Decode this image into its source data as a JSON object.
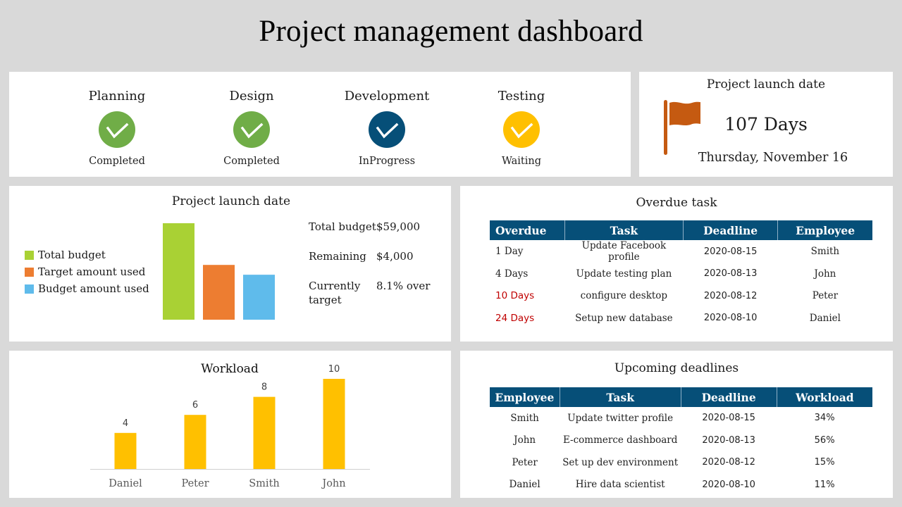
{
  "title": "Project management dashboard",
  "phases": [
    {
      "name": "Planning",
      "status": "Completed",
      "icon": "check-circle-icon",
      "color": "#70ad47"
    },
    {
      "name": "Design",
      "status": "Completed",
      "icon": "check-circle-icon",
      "color": "#70ad47"
    },
    {
      "name": "Development",
      "status": "InProgress",
      "icon": "check-circle-icon",
      "color": "#064f78"
    },
    {
      "name": "Testing",
      "status": "Waiting",
      "icon": "check-circle-icon",
      "color": "#ffc000"
    }
  ],
  "launch": {
    "title": "Project launch date",
    "icon": "flag-icon",
    "icon_color": "#c55a11",
    "days": "107 Days",
    "date": "Thursday, November 16"
  },
  "budget": {
    "title": "Project launch date",
    "stats": [
      {
        "label": "Total budget",
        "value": "$59,000"
      },
      {
        "label": "Remaining",
        "value": "$4,000"
      },
      {
        "label": "Currently target",
        "value": "8.1% over"
      }
    ]
  },
  "overdue": {
    "title": "Overdue task",
    "headers": [
      "Overdue",
      "Task",
      "Deadline",
      "Employee"
    ],
    "rows": [
      {
        "overdue": "1 Day",
        "task": "Update Facebook profile",
        "deadline": "2020-08-15",
        "employee": "Smith",
        "alert": false
      },
      {
        "overdue": "4 Days",
        "task": "Update testing plan",
        "deadline": "2020-08-13",
        "employee": "John",
        "alert": false
      },
      {
        "overdue": "10 Days",
        "task": "configure desktop",
        "deadline": "2020-08-12",
        "employee": "Peter",
        "alert": true
      },
      {
        "overdue": "24 Days",
        "task": "Setup new database",
        "deadline": "2020-08-10",
        "employee": "Daniel",
        "alert": true
      }
    ],
    "alert_color": "#c00000",
    "header_color": "#064f78"
  },
  "upcoming": {
    "title": "Upcoming deadlines",
    "headers": [
      "Employee",
      "Task",
      "Deadline",
      "Workload"
    ],
    "rows": [
      {
        "employee": "Smith",
        "task": "Update twitter profile",
        "deadline": "2020-08-15",
        "workload": "34%"
      },
      {
        "employee": "John",
        "task": "E-commerce dashboard",
        "deadline": "2020-08-13",
        "workload": "56%"
      },
      {
        "employee": "Peter",
        "task": "Set up dev environment",
        "deadline": "2020-08-12",
        "workload": "15%"
      },
      {
        "employee": "Daniel",
        "task": "Hire data scientist",
        "deadline": "2020-08-10",
        "workload": "11%"
      }
    ]
  },
  "chart_data": [
    {
      "type": "bar",
      "title": "Project launch date",
      "categories": [
        "Total budget",
        "Target amount used",
        "Budget amount used"
      ],
      "values": [
        59000,
        33500,
        27500
      ],
      "colors": [
        "#a9d134",
        "#ed7d31",
        "#5fbbeb"
      ],
      "legend": "left",
      "grid": false,
      "ylim": [
        0,
        59000
      ]
    },
    {
      "type": "bar",
      "title": "Workload",
      "categories": [
        "Daniel",
        "Peter",
        "Smith",
        "John"
      ],
      "values": [
        4,
        6,
        8,
        10
      ],
      "data_labels": [
        "4",
        "6",
        "8",
        "10"
      ],
      "color": "#ffc000",
      "xlabel": "",
      "ylabel": "",
      "ylim": [
        0,
        10
      ],
      "grid": false
    }
  ]
}
